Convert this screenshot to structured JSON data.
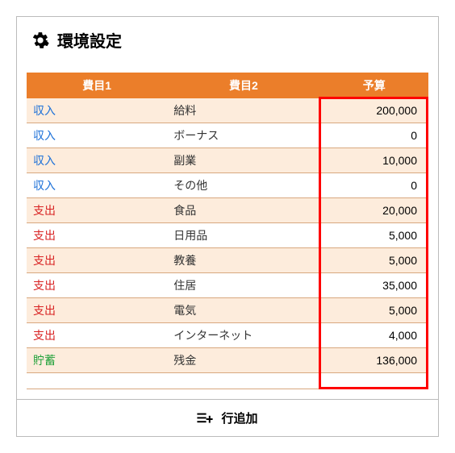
{
  "header": {
    "title": "環境設定"
  },
  "table": {
    "columns": [
      "費目1",
      "費目2",
      "予算"
    ],
    "rows": [
      {
        "type": "収入",
        "typeClass": "type-income",
        "item": "給料",
        "budget": "200,000"
      },
      {
        "type": "収入",
        "typeClass": "type-income",
        "item": "ボーナス",
        "budget": "0"
      },
      {
        "type": "収入",
        "typeClass": "type-income",
        "item": "副業",
        "budget": "10,000"
      },
      {
        "type": "収入",
        "typeClass": "type-income",
        "item": "その他",
        "budget": "0"
      },
      {
        "type": "支出",
        "typeClass": "type-expense",
        "item": "食品",
        "budget": "20,000"
      },
      {
        "type": "支出",
        "typeClass": "type-expense",
        "item": "日用品",
        "budget": "5,000"
      },
      {
        "type": "支出",
        "typeClass": "type-expense",
        "item": "教養",
        "budget": "5,000"
      },
      {
        "type": "支出",
        "typeClass": "type-expense",
        "item": "住居",
        "budget": "35,000"
      },
      {
        "type": "支出",
        "typeClass": "type-expense",
        "item": "電気",
        "budget": "5,000"
      },
      {
        "type": "支出",
        "typeClass": "type-expense",
        "item": "インターネット",
        "budget": "4,000"
      },
      {
        "type": "貯蓄",
        "typeClass": "type-saving",
        "item": "残金",
        "budget": "136,000"
      }
    ]
  },
  "addRow": {
    "label": "行追加"
  }
}
